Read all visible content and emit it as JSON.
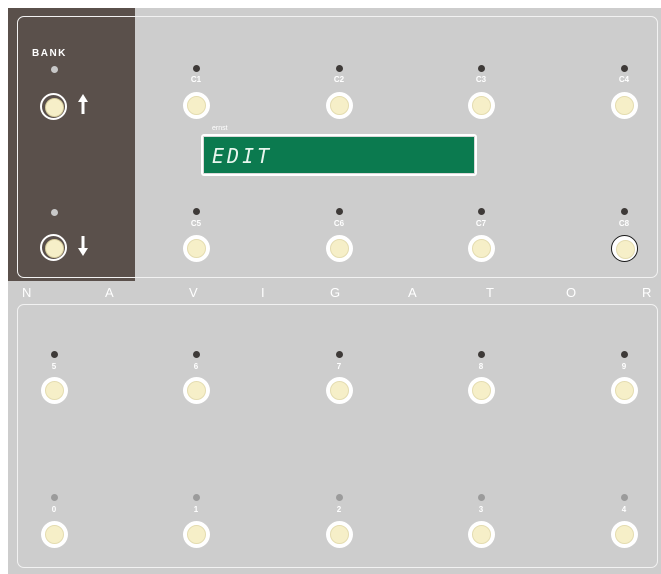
{
  "bank": {
    "label": "BANK"
  },
  "display": {
    "caption": "ernst",
    "text": "EDIT"
  },
  "brand": {
    "letters": [
      "N",
      "A",
      "V",
      "I",
      "G",
      "A",
      "T",
      "O",
      "R"
    ]
  },
  "upper_row": [
    {
      "label": "C1",
      "led": "dark"
    },
    {
      "label": "C2",
      "led": "dark"
    },
    {
      "label": "C3",
      "led": "dark"
    },
    {
      "label": "C4",
      "led": "dark"
    }
  ],
  "lower_row": [
    {
      "label": "C5",
      "led": "dark"
    },
    {
      "label": "C6",
      "led": "dark"
    },
    {
      "label": "C7",
      "led": "dark"
    },
    {
      "label": "C8",
      "led": "dark",
      "selected": true
    }
  ],
  "number_row_top": [
    {
      "label": "5",
      "led": "dark"
    },
    {
      "label": "6",
      "led": "dark"
    },
    {
      "label": "7",
      "led": "dark"
    },
    {
      "label": "8",
      "led": "dark"
    },
    {
      "label": "9",
      "led": "dark"
    }
  ],
  "number_row_bottom": [
    {
      "label": "0",
      "led": "gray"
    },
    {
      "label": "1",
      "led": "gray"
    },
    {
      "label": "2",
      "led": "gray"
    },
    {
      "label": "3",
      "led": "gray"
    },
    {
      "label": "4",
      "led": "gray"
    }
  ],
  "colors": {
    "panel": "#cdcdcd",
    "bank_panel": "#5a504b",
    "lcd": "#0b7a4f",
    "switch": "#f6efc8"
  },
  "icons": {
    "bank_up": "arrow-up-icon",
    "bank_down": "arrow-down-icon"
  }
}
